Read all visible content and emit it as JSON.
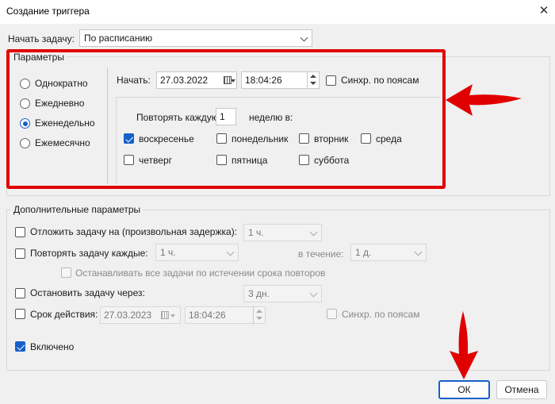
{
  "window": {
    "title": "Создание триггера",
    "close_glyph": "✕"
  },
  "start_task": {
    "label": "Начать задачу:",
    "value": "По расписанию"
  },
  "params": {
    "legend": "Параметры",
    "radios": [
      {
        "label": "Однократно",
        "checked": false
      },
      {
        "label": "Ежедневно",
        "checked": false
      },
      {
        "label": "Еженедельно",
        "checked": true
      },
      {
        "label": "Ежемесячно",
        "checked": false
      }
    ],
    "start_label": "Начать:",
    "start_date": "27.03.2022",
    "start_time": "18:04:26",
    "sync_label": "Синхр. по поясам",
    "repeat_every_label": "Повторять каждую",
    "repeat_every_value": "1",
    "weeks_on_label": "неделю в:",
    "days": [
      {
        "label": "воскресенье",
        "checked": true
      },
      {
        "label": "понедельник",
        "checked": false
      },
      {
        "label": "вторник",
        "checked": false
      },
      {
        "label": "среда",
        "checked": false
      },
      {
        "label": "четверг",
        "checked": false
      },
      {
        "label": "пятница",
        "checked": false
      },
      {
        "label": "суббота",
        "checked": false
      }
    ]
  },
  "advanced": {
    "legend": "Дополнительные параметры",
    "delay_label": "Отложить задачу на (произвольная задержка):",
    "delay_value": "1 ч.",
    "repeat_label": "Повторять задачу каждые:",
    "repeat_value": "1 ч.",
    "duration_label": "в течение:",
    "duration_value": "1 д.",
    "stop_all_label": "Останавливать все задачи по истечении срока повторов",
    "stop_after_label": "Остановить задачу через:",
    "stop_after_value": "3 дн.",
    "expire_label": "Срок действия:",
    "expire_date": "27.03.2023",
    "expire_time": "18:04:26",
    "expire_sync_label": "Синхр. по поясам",
    "enabled_label": "Включено"
  },
  "buttons": {
    "ok": "ОК",
    "cancel": "Отмена"
  },
  "colors": {
    "highlight": "#e00000",
    "accent": "#1560c9"
  }
}
